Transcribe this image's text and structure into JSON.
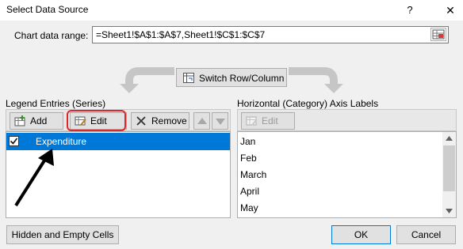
{
  "window": {
    "title": "Select Data Source",
    "help": "?",
    "close": "✕"
  },
  "range": {
    "label": "Chart data range:",
    "value": "=Sheet1!$A$1:$A$7,Sheet1!$C$1:$C$7"
  },
  "switch_button": {
    "label": "Switch Row/Column"
  },
  "legend": {
    "heading": "Legend Entries (Series)",
    "add_label": "Add",
    "edit_label": "Edit",
    "remove_label": "Remove",
    "items": [
      {
        "label": "Expenditure",
        "checked": true,
        "selected": true
      }
    ]
  },
  "axis": {
    "heading": "Horizontal (Category) Axis Labels",
    "edit_label": "Edit",
    "items": [
      "Jan",
      "Feb",
      "March",
      "April",
      "May"
    ]
  },
  "footer": {
    "hidden_cells_label": "Hidden and Empty Cells",
    "ok_label": "OK",
    "cancel_label": "Cancel"
  },
  "colors": {
    "selection": "#0078d7",
    "highlight": "#e0262a"
  }
}
